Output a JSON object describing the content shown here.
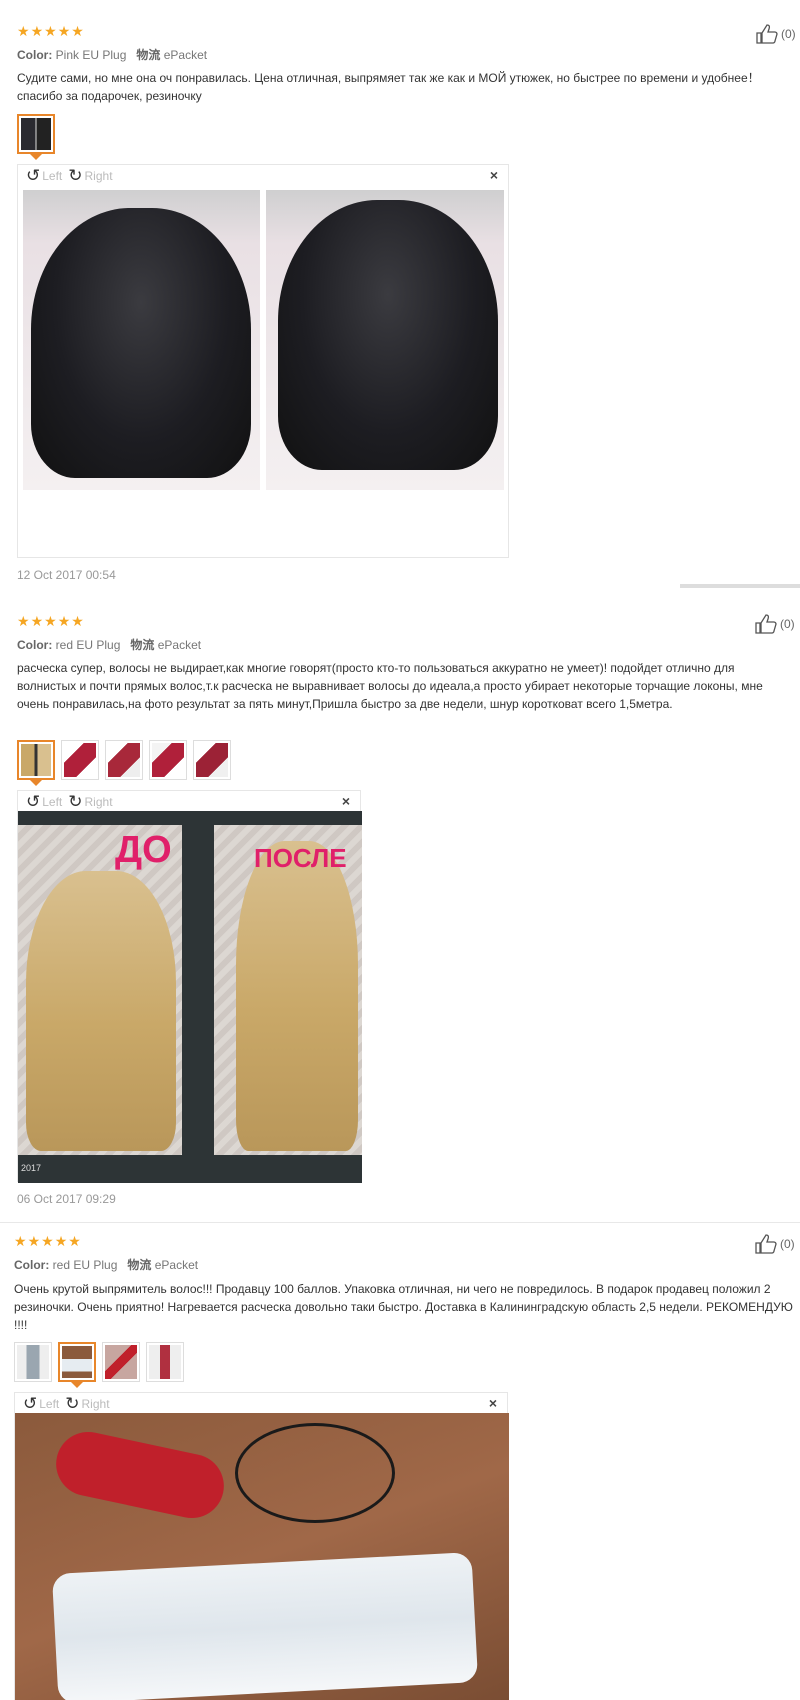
{
  "reviews": [
    {
      "stars": 5,
      "color_label": "Color:",
      "color_value": "Pink EU Plug",
      "shipping_label": "物流",
      "shipping_value": "ePacket",
      "likes": "(0)",
      "text": "Судите сами, но мне она оч понравилась. Цена отличная, выпрямяет так же как и МОЙ утюжек, но быстрее по времени и удобнее！ спасибо за подарочек, резиночку",
      "viewer": {
        "left": "Left",
        "right": "Right",
        "close": "×"
      },
      "date": "12 Oct 2017 00:54"
    },
    {
      "stars": 5,
      "color_label": "Color:",
      "color_value": "red EU Plug",
      "shipping_label": "物流",
      "shipping_value": "ePacket",
      "likes": "(0)",
      "text": "расческа супер, волосы не выдирает,как многие говорят(просто кто-то пользоваться аккуратно не умеет)! подойдет отлично для волнистых и почти прямых волос,т.к расческа не выравнивает волосы до идеала,а просто убирает некоторые торчащие локоны, мне очень понравилась,на фото результат за пять минут,Пришла быстро за две недели, шнур коротковат всего 1,5метра.",
      "viewer": {
        "left": "Left",
        "right": "Right",
        "close": "×"
      },
      "photo_text_before": "ДО",
      "photo_text_after": "ПОСЛЕ",
      "photo_year": "2017",
      "date": "06 Oct 2017 09:29"
    },
    {
      "stars": 5,
      "color_label": "Color:",
      "color_value": "red EU Plug",
      "shipping_label": "物流",
      "shipping_value": "ePacket",
      "likes": "(0)",
      "text": "Очень крутой выпрямитель волос!!! Продавцу 100 баллов. Упаковка отличная, ни чего не повредилось. В подарок продавец положил 2 резиночки. Очень приятно! Нагревается расческа довольно таки быстро. Доставка в Калининградскую область 2,5 недели. РЕКОМЕНДУЮ !!!!",
      "viewer": {
        "left": "Left",
        "right": "Right",
        "close": "×"
      }
    }
  ],
  "colors": {
    "star": "#f5a623",
    "accent": "#e8862a"
  }
}
